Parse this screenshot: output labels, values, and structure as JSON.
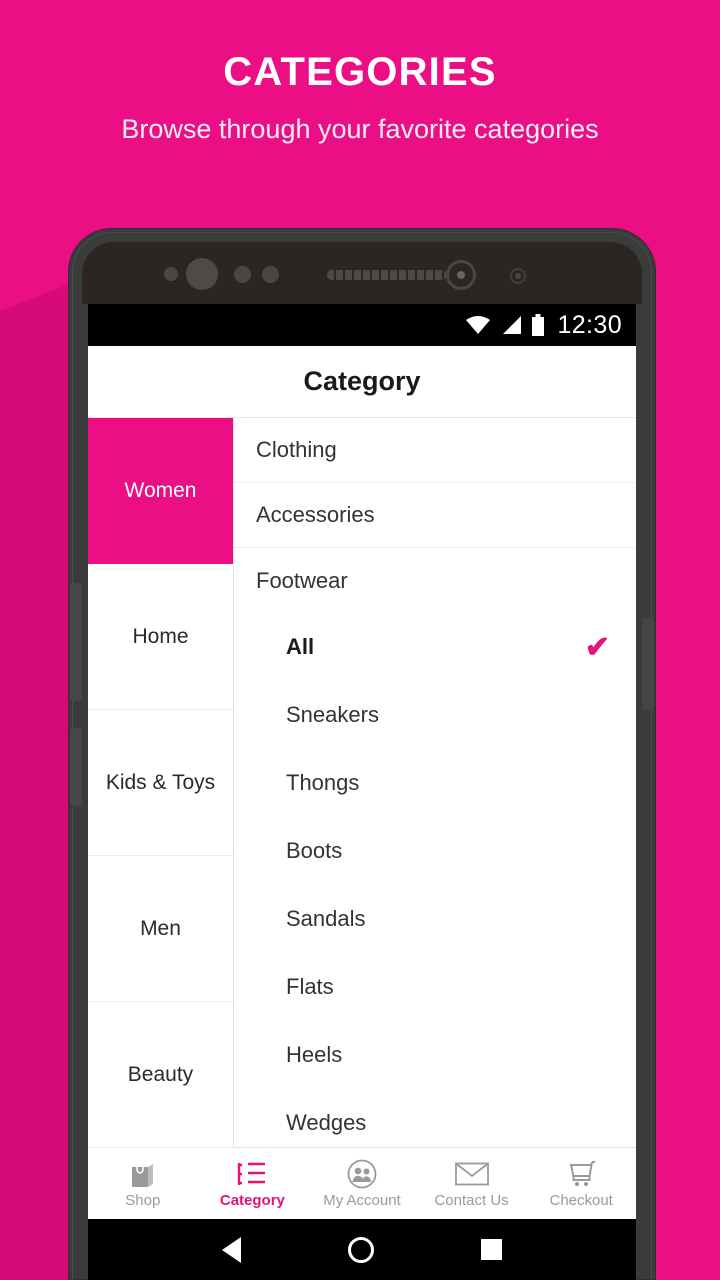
{
  "promo": {
    "title": "CATEGORIES",
    "subtitle": "Browse through your favorite categories"
  },
  "theme": {
    "background_pink": "#EC0E85",
    "accent_pink": "#E5127E",
    "shadow_pink": "#cf0a74"
  },
  "statusbar": {
    "time": "12:30",
    "icons": [
      "wifi-icon",
      "signal-icon",
      "battery-icon"
    ]
  },
  "appbar": {
    "title": "Category"
  },
  "sidebar": {
    "items": [
      {
        "label": "Women",
        "active": true
      },
      {
        "label": "Home",
        "active": false
      },
      {
        "label": "Kids & Toys",
        "active": false
      },
      {
        "label": "Men",
        "active": false
      },
      {
        "label": "Beauty",
        "active": false
      }
    ]
  },
  "content": {
    "categories": [
      {
        "label": "Clothing",
        "level": "top",
        "divider": true,
        "selected": false
      },
      {
        "label": "Accessories",
        "level": "top",
        "divider": true,
        "selected": false
      },
      {
        "label": "Footwear",
        "level": "top",
        "divider": false,
        "selected": false
      },
      {
        "label": "All",
        "level": "sub",
        "divider": false,
        "selected": true
      },
      {
        "label": "Sneakers",
        "level": "sub",
        "divider": false,
        "selected": false
      },
      {
        "label": "Thongs",
        "level": "sub",
        "divider": false,
        "selected": false
      },
      {
        "label": "Boots",
        "level": "sub",
        "divider": false,
        "selected": false
      },
      {
        "label": "Sandals",
        "level": "sub",
        "divider": false,
        "selected": false
      },
      {
        "label": "Flats",
        "level": "sub",
        "divider": false,
        "selected": false
      },
      {
        "label": "Heels",
        "level": "sub",
        "divider": false,
        "selected": false
      },
      {
        "label": "Wedges",
        "level": "sub",
        "divider": false,
        "selected": false
      }
    ],
    "selected_check": "✔"
  },
  "tabbar": {
    "tabs": [
      {
        "label": "Shop",
        "icon": "shopping-bag-icon",
        "active": false
      },
      {
        "label": "Category",
        "icon": "list-icon",
        "active": true
      },
      {
        "label": "My Account",
        "icon": "people-circle-icon",
        "active": false
      },
      {
        "label": "Contact Us",
        "icon": "envelope-icon",
        "active": false
      },
      {
        "label": "Checkout",
        "icon": "shopping-cart-icon",
        "active": false
      }
    ]
  },
  "navbar": {
    "buttons": [
      {
        "name": "back-button",
        "icon": "triangle-left-icon"
      },
      {
        "name": "home-button",
        "icon": "circle-icon"
      },
      {
        "name": "recents-button",
        "icon": "square-icon"
      }
    ]
  }
}
